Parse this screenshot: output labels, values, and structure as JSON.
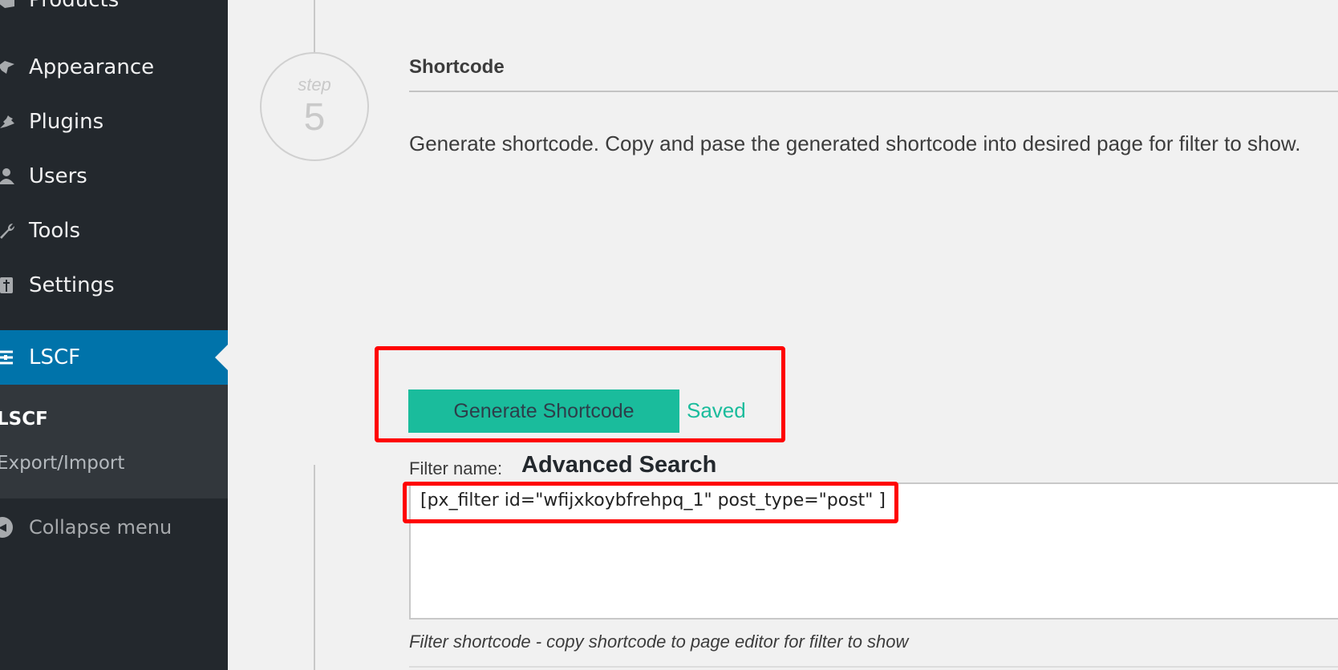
{
  "sidebar": {
    "items": [
      {
        "label": "Products",
        "icon": "products-icon"
      },
      {
        "label": "Appearance",
        "icon": "paintbrush-icon"
      },
      {
        "label": "Plugins",
        "icon": "plug-icon"
      },
      {
        "label": "Users",
        "icon": "user-icon"
      },
      {
        "label": "Tools",
        "icon": "wrench-icon"
      },
      {
        "label": "Settings",
        "icon": "settings-icon"
      },
      {
        "label": "LSCF",
        "icon": "filter-sliders-icon",
        "active": true
      }
    ],
    "submenu": [
      {
        "label": "LSCF",
        "current": true
      },
      {
        "label": "Export/Import"
      }
    ],
    "collapse_label": "Collapse menu",
    "active_color": "#0073aa"
  },
  "step": {
    "word": "step",
    "number": "5",
    "title": "Shortcode",
    "description": "Generate shortcode. Copy and pase the generated shortcode into desired page for filter to show."
  },
  "actions": {
    "generate_label": "Generate Shortcode",
    "saved_label": "Saved",
    "accent_color": "#1abc9c"
  },
  "filter": {
    "name_label": "Filter name:",
    "name_value": "Advanced Search",
    "shortcode": "[px_filter id=\"wfijxkoybfrehpq_1\" post_type=\"post\" ]",
    "hint": "Filter shortcode - copy shortcode to page editor for filter to show"
  },
  "annotations": {
    "highlight_color": "#ff0000"
  }
}
